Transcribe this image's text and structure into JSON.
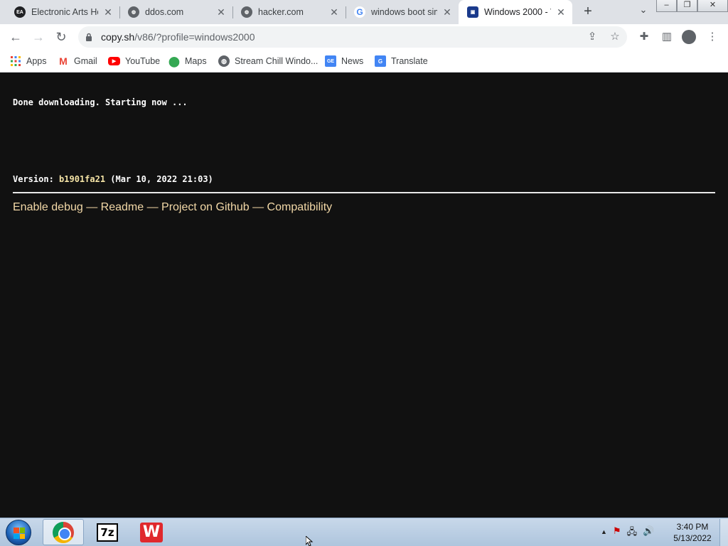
{
  "tabs": [
    {
      "title": "Electronic Arts Ho",
      "favicon": "ea-icon",
      "fav_text": "EA"
    },
    {
      "title": "ddos.com",
      "favicon": "globe-icon"
    },
    {
      "title": "hacker.com",
      "favicon": "globe-icon"
    },
    {
      "title": "windows boot sim",
      "favicon": "google-icon",
      "fav_text": "G"
    },
    {
      "title": "Windows 2000 - V",
      "favicon": "v86-icon",
      "active": true
    }
  ],
  "window_buttons": {
    "minimize": "–",
    "restore": "❐",
    "close": "✕"
  },
  "toolbar": {
    "back": "←",
    "forward": "→",
    "reload": "↻",
    "url_host": "copy.sh",
    "url_path": "/v86/?profile=windows2000"
  },
  "bookmarks": [
    {
      "label": "Apps",
      "icon": "apps-grid-icon"
    },
    {
      "label": "Gmail",
      "icon": "gmail-icon"
    },
    {
      "label": "YouTube",
      "icon": "youtube-icon"
    },
    {
      "label": "Maps",
      "icon": "maps-pin-icon"
    },
    {
      "label": "Stream Chill Windo...",
      "icon": "globe-icon"
    },
    {
      "label": "News",
      "icon": "news-icon"
    },
    {
      "label": "Translate",
      "icon": "translate-icon"
    }
  ],
  "page": {
    "status": "Done downloading. Starting now ...",
    "version_label": "Version: ",
    "version_hash": "b1901fa21",
    "version_date": " (Mar 10, 2022 21:03)",
    "links": [
      "Enable debug",
      "Readme",
      "Project on Github",
      "Compatibility"
    ],
    "separator": " — "
  },
  "taskbar": {
    "apps": [
      "Google Chrome",
      "7-Zip",
      "WPS Office"
    ],
    "sevenz_label": "7z",
    "wps_label": "W",
    "tray_up": "▲",
    "time": "3:40 PM",
    "date": "5/13/2022"
  },
  "colors": {
    "page_bg": "#111111",
    "link": "#f2d8a7",
    "hash": "#f5e4a6"
  }
}
